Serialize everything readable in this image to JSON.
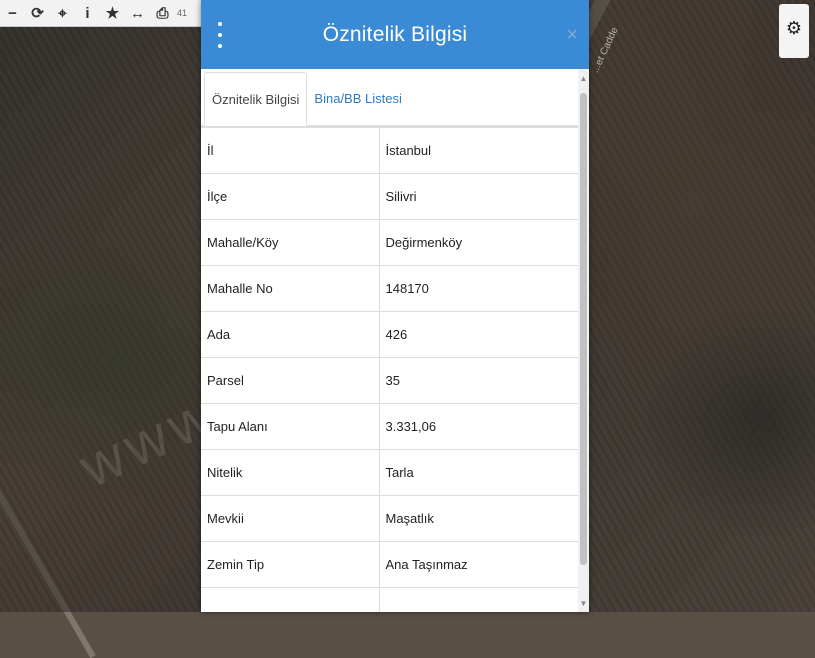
{
  "toolbar": {
    "icons": [
      "zoom-out-icon",
      "refresh-icon",
      "locate-icon",
      "info-icon",
      "star-icon",
      "measure-icon",
      "print-icon"
    ],
    "glyphs": [
      "−",
      "⟳",
      "⌖",
      "i",
      "★",
      "↔",
      "⎙"
    ],
    "trailing": "41"
  },
  "dialog": {
    "title": "Öznitelik Bilgisi",
    "close": "×",
    "tabs": [
      {
        "label": "Öznitelik Bilgisi",
        "active": true
      },
      {
        "label": "Bina/BB Listesi",
        "active": false
      }
    ],
    "rows": [
      {
        "key": "İl",
        "value": "İstanbul"
      },
      {
        "key": "İlçe",
        "value": "Silivri"
      },
      {
        "key": "Mahalle/Köy",
        "value": "Değirmenköy"
      },
      {
        "key": "Mahalle No",
        "value": "148170"
      },
      {
        "key": "Ada",
        "value": "426"
      },
      {
        "key": "Parsel",
        "value": "35"
      },
      {
        "key": "Tapu Alanı",
        "value": "3.331,06"
      },
      {
        "key": "Nitelik",
        "value": "Tarla"
      },
      {
        "key": "Mevkii",
        "value": "Maşatlık"
      },
      {
        "key": "Zemin Tip",
        "value": "Ana Taşınmaz"
      },
      {
        "key": "",
        "value": ""
      }
    ]
  },
  "map": {
    "road_label": "...et Cadde",
    "watermark": "www.........net.tr"
  },
  "colors": {
    "header": "#3b8ad6",
    "tab_link": "#2f7bc4"
  }
}
